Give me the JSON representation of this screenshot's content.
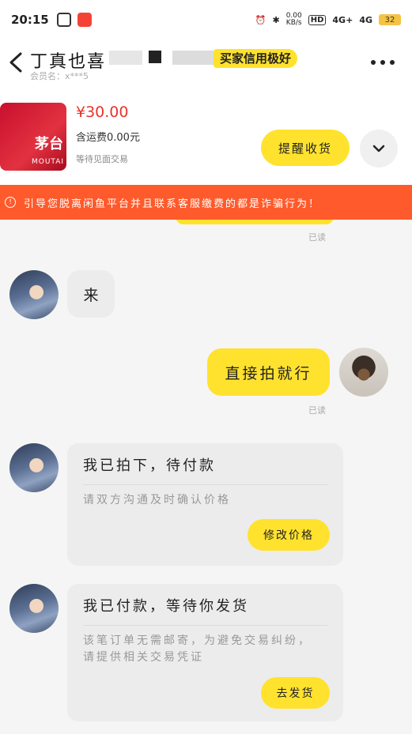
{
  "status_bar": {
    "time": "20:15",
    "speed_value": "0.00",
    "speed_unit": "KB/s",
    "hd_label": "HD",
    "net1": "4G+",
    "net2": "4G",
    "battery": "32"
  },
  "header": {
    "seller_name": "丁真也喜",
    "badge": "买家信用极好",
    "member_label": "会员名：x***5"
  },
  "product": {
    "price": "¥30.00",
    "shipping": "含运费0.00元",
    "status": "等待见面交易",
    "image_brand": "茅台",
    "image_brand_en": "MOUTAI",
    "remind_button": "提醒收货"
  },
  "warning": {
    "text": "引导您脱离闲鱼平台并且联系客服缴费的都是诈骗行为！"
  },
  "messages": {
    "read_1": "已读",
    "msg_1": "来",
    "msg_2": "直接拍就行",
    "read_2": "已读"
  },
  "cards": [
    {
      "title": "我已拍下，待付款",
      "desc": "请双方沟通及时确认价格",
      "button": "修改价格"
    },
    {
      "title": "我已付款，等待你发货",
      "desc": "该笔订单无需邮寄，为避免交易纠纷，请提供相关交易凭证",
      "button": "去发货"
    }
  ]
}
